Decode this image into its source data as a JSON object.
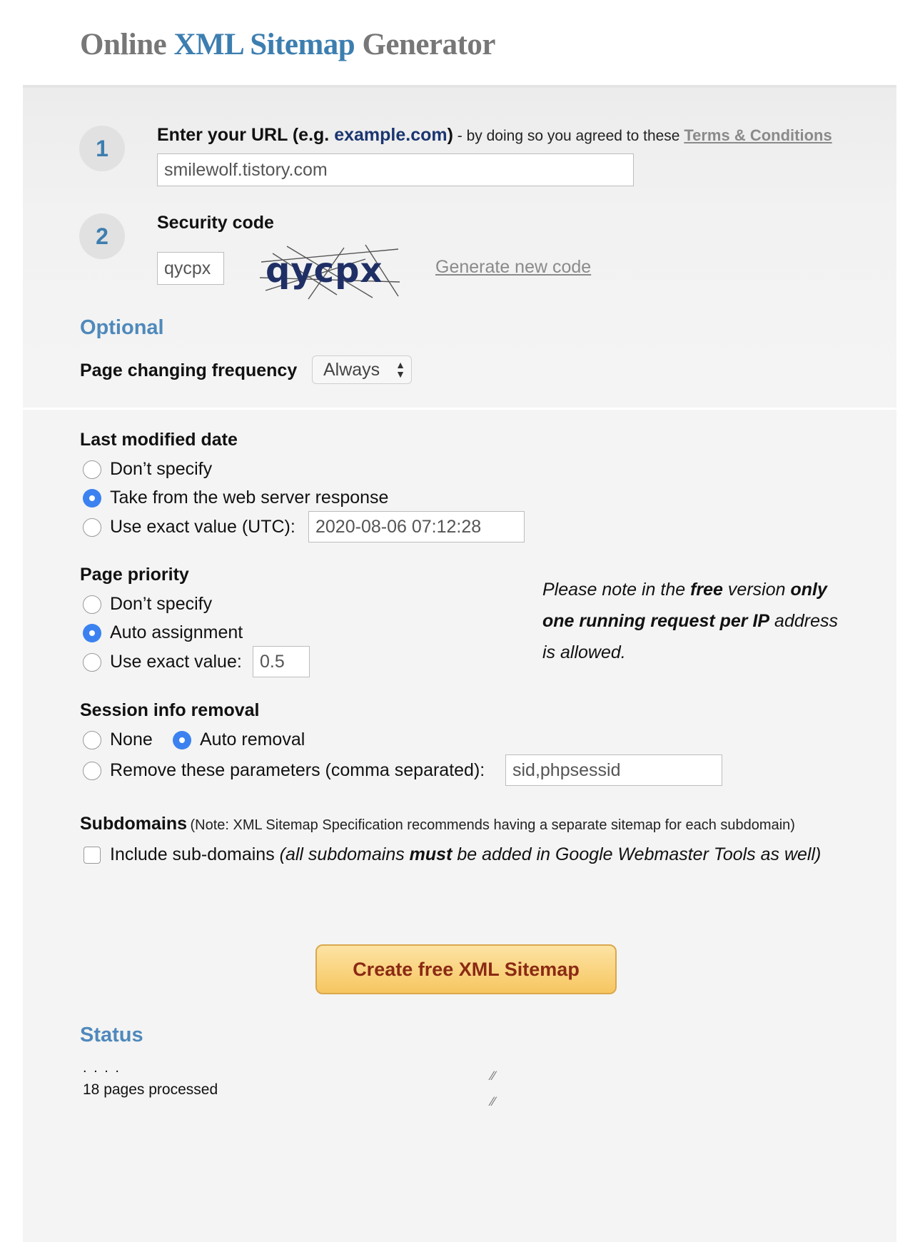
{
  "header": {
    "title_part1": "Online",
    "title_part2": "XML Sitemap",
    "title_part3": "Generator"
  },
  "step1": {
    "number": "1",
    "label": "Enter your URL (e.g. ",
    "example": "example.com",
    "label_close": ")",
    "agreement": " - by doing so you agreed to these ",
    "terms_link": "Terms & Conditions",
    "url_value": "smilewolf.tistory.com"
  },
  "step2": {
    "number": "2",
    "label": "Security code",
    "code_value": "qycpx",
    "captcha_text": "qycpx",
    "generate_link": "Generate new code"
  },
  "optional": {
    "heading": "Optional",
    "frequency_label": "Page changing frequency",
    "frequency_value": "Always"
  },
  "last_modified": {
    "heading": "Last modified date",
    "options": [
      "Don’t specify",
      "Take from the web server response",
      "Use exact value (UTC):"
    ],
    "selected": 1,
    "exact_value": "2020-08-06 07:12:28"
  },
  "priority": {
    "heading": "Page priority",
    "options": [
      "Don’t specify",
      "Auto assignment",
      "Use exact value:"
    ],
    "selected": 1,
    "exact_value": "0.5"
  },
  "note": {
    "p1": "Please note in the ",
    "b1": "free",
    "p2": " version ",
    "b2": "only one running request per IP",
    "p3": " address is allowed."
  },
  "session": {
    "heading": "Session info removal",
    "options": [
      "None",
      "Auto removal",
      "Remove these parameters (comma separated):"
    ],
    "selected": 1,
    "params_value": "sid,phpsessid"
  },
  "subdomains": {
    "heading": "Subdomains",
    "note": "(Note: XML Sitemap Specification recommends having a separate sitemap for each subdomain)",
    "checkbox_label": "Include sub-domains ",
    "checkbox_note_1": "(all subdomains ",
    "checkbox_note_bold": "must",
    "checkbox_note_2": " be added in Google Webmaster Tools as well)",
    "checked": false
  },
  "create_button": "Create free XML Sitemap",
  "status": {
    "heading": "Status",
    "progress_dots": ". . . .",
    "pages_processed": "18 pages processed"
  },
  "colors": {
    "accent_blue": "#3d7eb0",
    "radio_selected": "#3b82f0",
    "button_text": "#8b2a14",
    "button_bg": "#f6c660"
  }
}
